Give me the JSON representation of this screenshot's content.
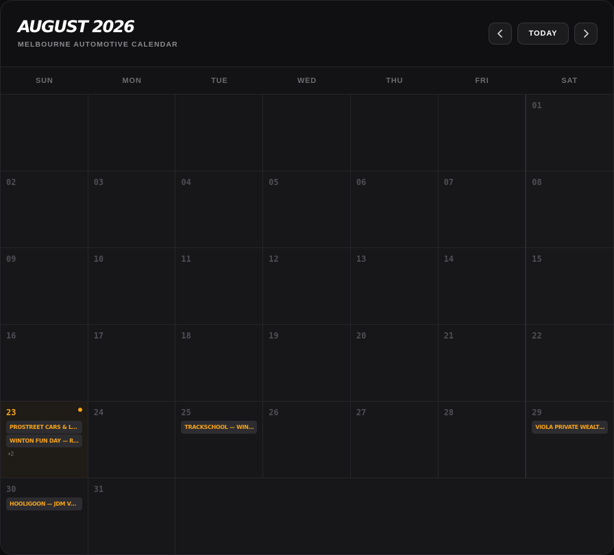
{
  "header": {
    "title": "AUGUST 2026",
    "subtitle": "MELBOURNE AUTOMOTIVE CALENDAR",
    "prev_icon": "chevron-left",
    "next_icon": "chevron-right",
    "today_label": "TODAY"
  },
  "colors": {
    "accent": "#f6a317",
    "background": "#17171a",
    "today_cell": "#1f1b16",
    "event_chip": "#2c2c31"
  },
  "weekdays": [
    "SUN",
    "MON",
    "TUE",
    "WED",
    "THU",
    "FRI",
    "SAT"
  ],
  "leading_blank_days": 6,
  "today": "23",
  "days": [
    {
      "num": "01",
      "events": []
    },
    {
      "num": "02",
      "events": []
    },
    {
      "num": "03",
      "events": []
    },
    {
      "num": "04",
      "events": []
    },
    {
      "num": "05",
      "events": []
    },
    {
      "num": "06",
      "events": []
    },
    {
      "num": "07",
      "events": []
    },
    {
      "num": "08",
      "events": []
    },
    {
      "num": "09",
      "events": []
    },
    {
      "num": "10",
      "events": []
    },
    {
      "num": "11",
      "events": []
    },
    {
      "num": "12",
      "events": []
    },
    {
      "num": "13",
      "events": []
    },
    {
      "num": "14",
      "events": []
    },
    {
      "num": "15",
      "events": []
    },
    {
      "num": "16",
      "events": []
    },
    {
      "num": "17",
      "events": []
    },
    {
      "num": "18",
      "events": []
    },
    {
      "num": "19",
      "events": []
    },
    {
      "num": "20",
      "events": []
    },
    {
      "num": "21",
      "events": []
    },
    {
      "num": "22",
      "events": []
    },
    {
      "num": "23",
      "events": [
        "PROSTREET CARS & LA…",
        "WINTON FUN DAY — R…"
      ],
      "more": "+2"
    },
    {
      "num": "24",
      "events": []
    },
    {
      "num": "25",
      "events": [
        "TRACKSCHOOL — WIN…"
      ]
    },
    {
      "num": "26",
      "events": []
    },
    {
      "num": "27",
      "events": []
    },
    {
      "num": "28",
      "events": []
    },
    {
      "num": "29",
      "events": [
        "VIOLA PRIVATE WEALT…"
      ]
    },
    {
      "num": "30",
      "events": [
        "HOOLIGOON — JDM VS…"
      ]
    },
    {
      "num": "31",
      "events": []
    }
  ]
}
